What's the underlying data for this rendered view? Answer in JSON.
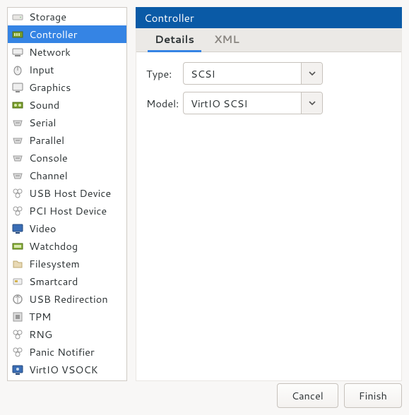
{
  "sidebar": {
    "items": [
      {
        "label": "Storage",
        "icon": "storage"
      },
      {
        "label": "Controller",
        "icon": "controller",
        "selected": true
      },
      {
        "label": "Network",
        "icon": "network"
      },
      {
        "label": "Input",
        "icon": "input"
      },
      {
        "label": "Graphics",
        "icon": "graphics"
      },
      {
        "label": "Sound",
        "icon": "sound"
      },
      {
        "label": "Serial",
        "icon": "serial"
      },
      {
        "label": "Parallel",
        "icon": "parallel"
      },
      {
        "label": "Console",
        "icon": "console"
      },
      {
        "label": "Channel",
        "icon": "channel"
      },
      {
        "label": "USB Host Device",
        "icon": "usb-host"
      },
      {
        "label": "PCI Host Device",
        "icon": "pci-host"
      },
      {
        "label": "Video",
        "icon": "video"
      },
      {
        "label": "Watchdog",
        "icon": "watchdog"
      },
      {
        "label": "Filesystem",
        "icon": "filesystem"
      },
      {
        "label": "Smartcard",
        "icon": "smartcard"
      },
      {
        "label": "USB Redirection",
        "icon": "usb-redir"
      },
      {
        "label": "TPM",
        "icon": "tpm"
      },
      {
        "label": "RNG",
        "icon": "rng"
      },
      {
        "label": "Panic Notifier",
        "icon": "panic"
      },
      {
        "label": "VirtIO VSOCK",
        "icon": "vsock"
      }
    ]
  },
  "header": {
    "title": "Controller"
  },
  "tabs": [
    {
      "label": "Details",
      "active": true
    },
    {
      "label": "XML",
      "active": false
    }
  ],
  "form": {
    "type_label": "Type:",
    "type_value": "SCSI",
    "model_label": "Model:",
    "model_value": "VirtIO SCSI"
  },
  "footer": {
    "cancel": "Cancel",
    "finish": "Finish"
  }
}
